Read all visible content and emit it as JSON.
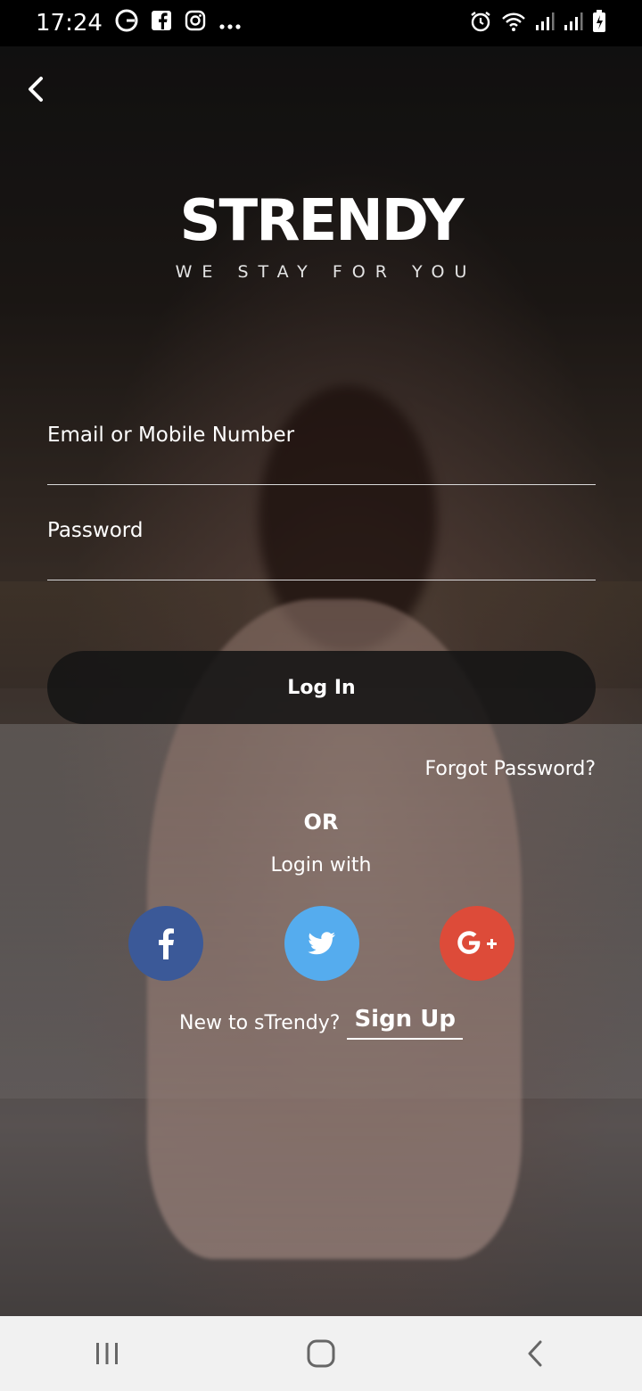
{
  "status_bar": {
    "time": "17:24",
    "icons": [
      "google-icon",
      "facebook-icon",
      "instagram-icon",
      "more-icon",
      "alarm-icon",
      "wifi-icon",
      "signal-icon",
      "signal-icon-2",
      "battery-icon"
    ]
  },
  "header": {
    "back_icon": "chevron-left-icon"
  },
  "brand": {
    "logo_text": "STRENDY",
    "tagline": "WE STAY FOR YOU"
  },
  "form": {
    "email_label": "Email or Mobile Number",
    "password_label": "Password",
    "login_button": "Log In",
    "forgot_password": "Forgot Password?"
  },
  "social": {
    "or_text": "OR",
    "login_with_text": "Login with",
    "buttons": [
      {
        "name": "facebook",
        "icon": "f",
        "color": "#3b5998"
      },
      {
        "name": "twitter",
        "icon": "twitter-bird-icon",
        "color": "#55acee"
      },
      {
        "name": "google",
        "icon": "G+",
        "color": "#dd4b39"
      }
    ]
  },
  "signup": {
    "prompt": "New to sTrendy?",
    "link": "Sign Up"
  },
  "nav_bar": {
    "buttons": [
      "recent-apps-icon",
      "home-icon",
      "back-icon"
    ]
  }
}
